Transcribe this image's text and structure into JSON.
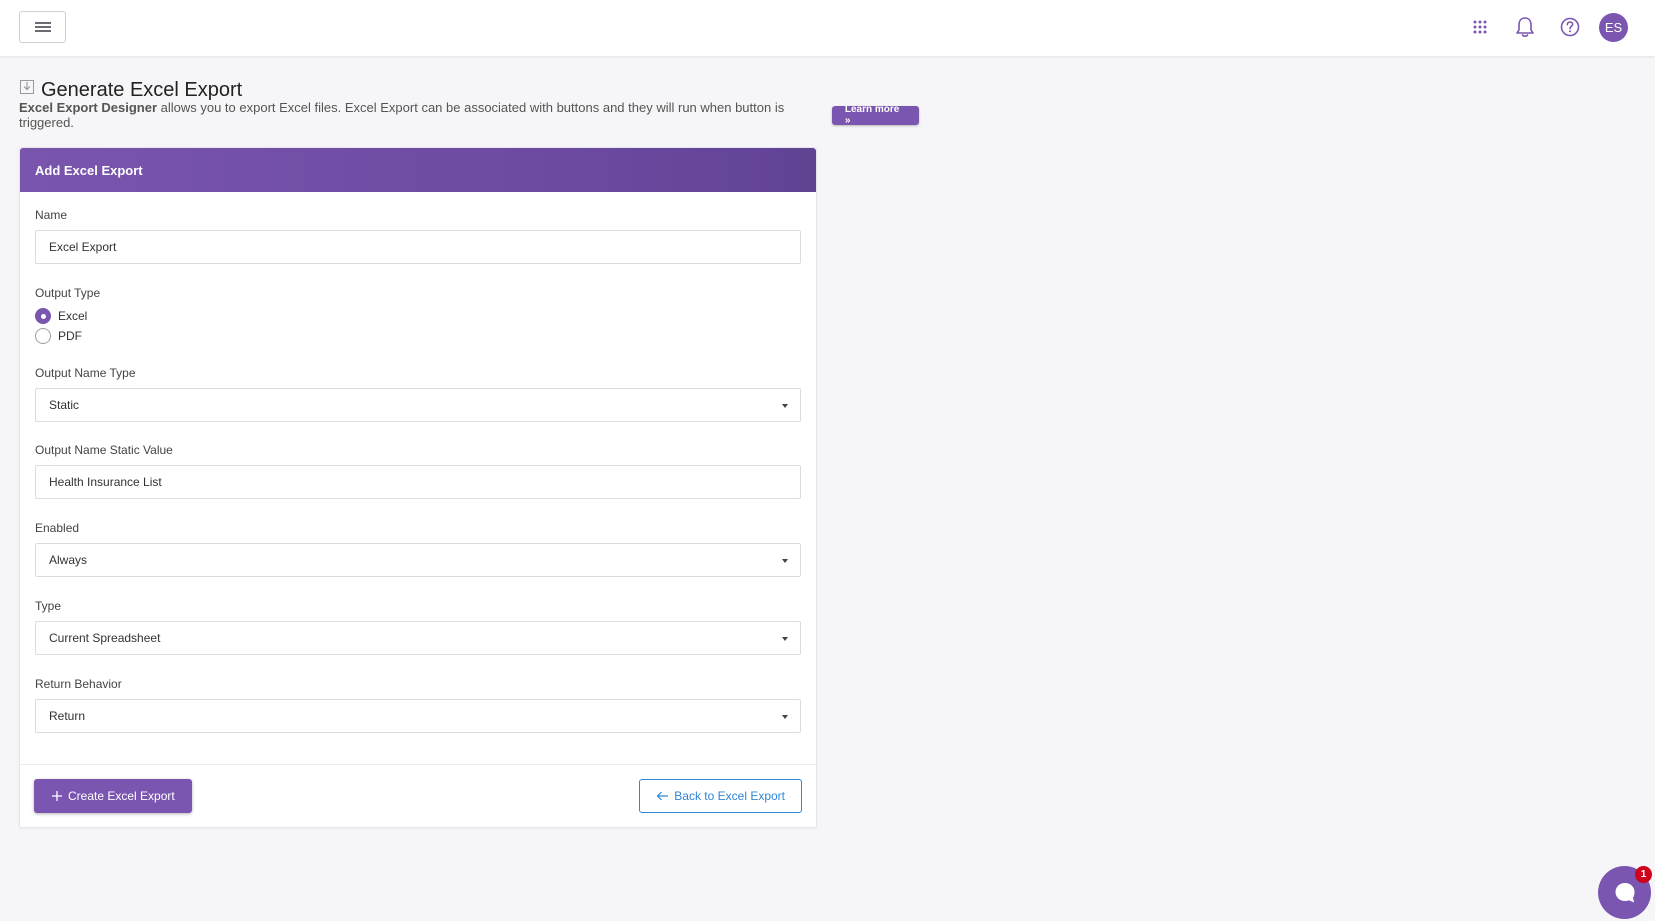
{
  "header": {
    "avatar_initials": "ES",
    "icons": [
      "menu-icon",
      "apps-grid-icon",
      "bell-icon",
      "help-icon"
    ]
  },
  "page": {
    "title": "Generate Excel Export",
    "description_bold": "Excel Export Designer",
    "description_rest": " allows you to export Excel files. Excel Export can be associated with buttons and they will run when button is triggered.",
    "learn_more": "Learn more »"
  },
  "form": {
    "card_title": "Add Excel Export",
    "name_label": "Name",
    "name_value": "Excel Export",
    "output_type_label": "Output Type",
    "output_type_options": [
      {
        "label": "Excel",
        "selected": true
      },
      {
        "label": "PDF",
        "selected": false
      }
    ],
    "output_name_type_label": "Output Name Type",
    "output_name_type_value": "Static",
    "output_name_static_label": "Output Name Static Value",
    "output_name_static_value": "Health Insurance List",
    "enabled_label": "Enabled",
    "enabled_value": "Always",
    "type_label": "Type",
    "type_value": "Current Spreadsheet",
    "return_behavior_label": "Return Behavior",
    "return_behavior_value": "Return"
  },
  "actions": {
    "create_label": "Create Excel Export",
    "back_label": "Back to Excel Export"
  },
  "chat": {
    "badge_count": "1"
  },
  "colors": {
    "accent": "#7b56b0",
    "link": "#2f86d8",
    "badge": "#d0021b"
  }
}
